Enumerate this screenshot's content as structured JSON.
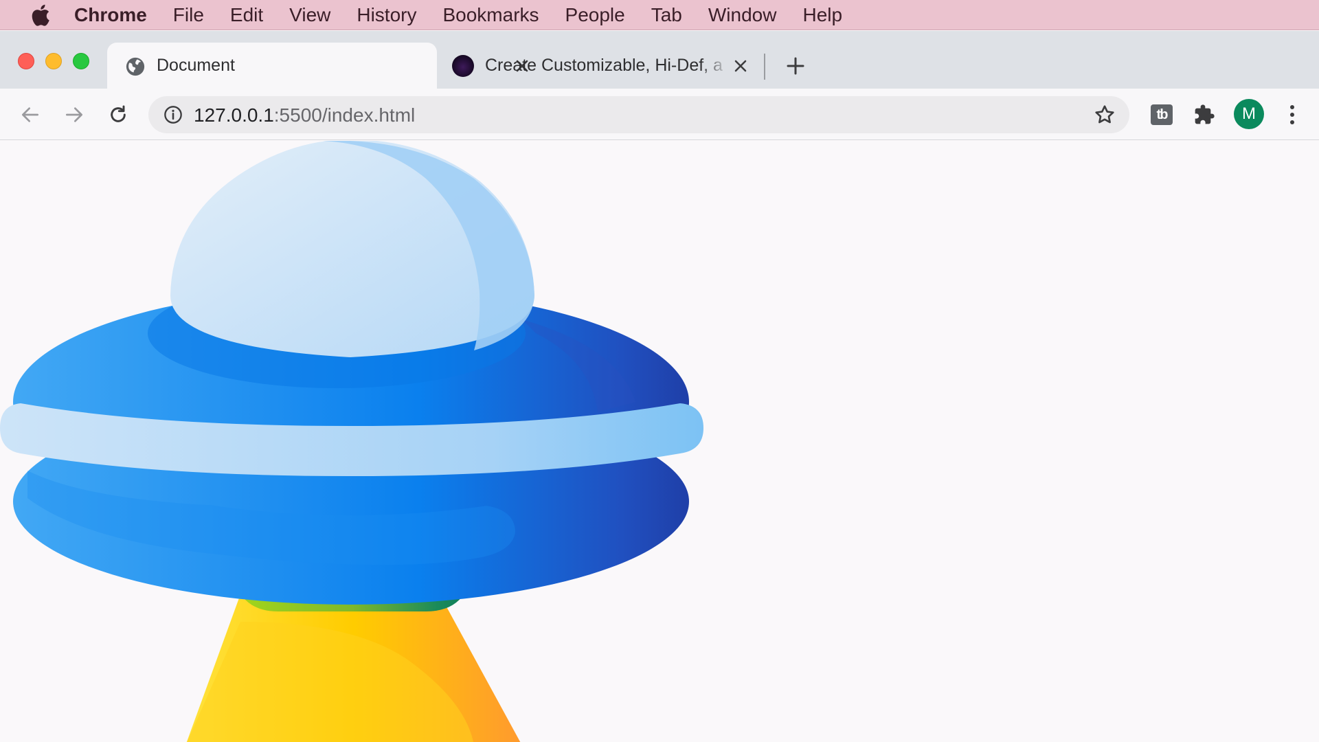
{
  "menubar": {
    "app_name": "Chrome",
    "items": [
      "File",
      "Edit",
      "View",
      "History",
      "Bookmarks",
      "People",
      "Tab",
      "Window",
      "Help"
    ]
  },
  "tabs": [
    {
      "title": "Document",
      "icon": "globe-icon",
      "active": true
    },
    {
      "title": "Create Customizable, Hi-Def, a",
      "icon": "site-favicon",
      "active": false
    }
  ],
  "toolbar": {
    "url_host": "127.0.0.1",
    "url_path": ":5500/index.html",
    "extension_label": "tb",
    "profile_initial": "M"
  },
  "colors": {
    "menubar_bg": "#ebc3cf",
    "tabstrip_bg": "#dee1e6",
    "avatar_bg": "#0b8a5d",
    "ufo_body_blue": "#0a84ee",
    "ufo_dome": "#cfe4f6",
    "ufo_beam": "#ffcf1a",
    "ufo_neck_green": "#8cc63f"
  }
}
